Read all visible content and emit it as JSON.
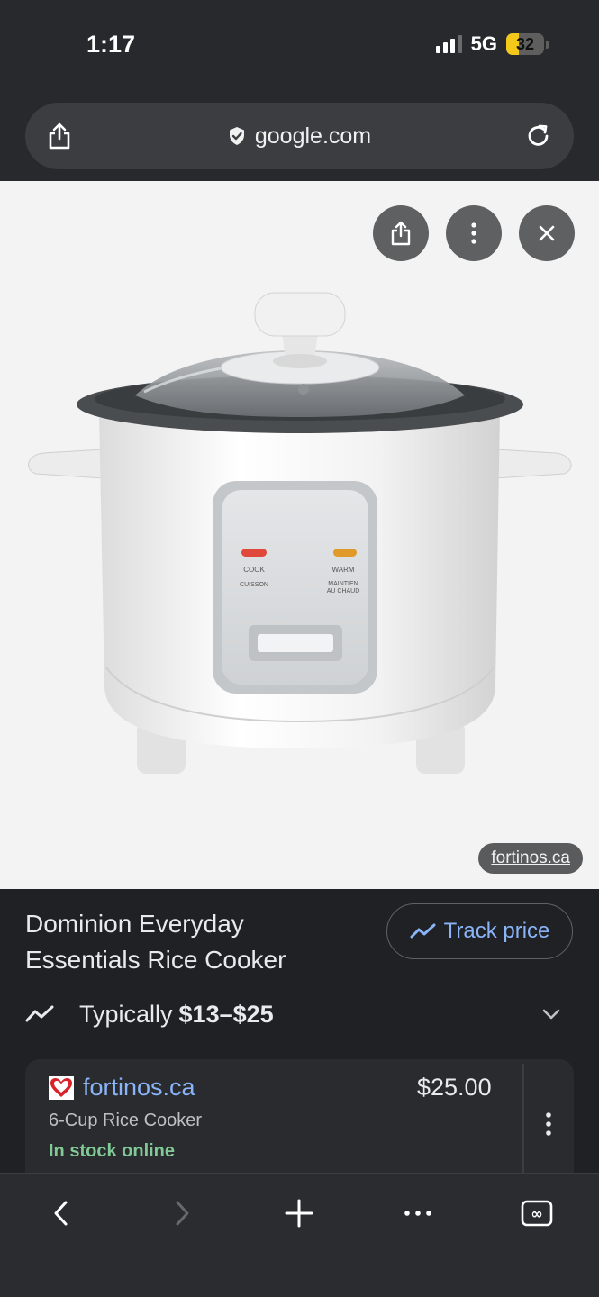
{
  "status_bar": {
    "time": "1:17",
    "network": "5G",
    "battery": "32"
  },
  "browser": {
    "url": "google.com",
    "icons": [
      "share-icon",
      "shield-icon",
      "reload-icon"
    ]
  },
  "image_viewer": {
    "source_label": "fortinos.ca",
    "panel_labels": {
      "cook": "COOK",
      "cuisson": "CUISSON",
      "warm": "WARM",
      "maintien_1": "MAINTIEN",
      "maintien_2": "AU CHAUD"
    },
    "buttons": [
      "share-icon",
      "more-vert-icon",
      "close-icon"
    ]
  },
  "product": {
    "title_line1": "Dominion Everyday",
    "title_line2": "Essentials Rice Cooker",
    "track_price_label": "Track price",
    "typical_label": "Typically",
    "typical_range": "$13–$25"
  },
  "offer": {
    "merchant": "fortinos.ca",
    "price": "$25.00",
    "description": "6-Cup Rice Cooker",
    "stock_status": "In stock online"
  },
  "toolbar": {
    "buttons": [
      "back-icon",
      "forward-icon",
      "new-tab-icon",
      "more-icon",
      "tabs-icon"
    ],
    "tabs_count": "∞"
  },
  "colors": {
    "accent_blue": "#8ab4f8",
    "in_stock_green": "#81c995",
    "background": "#202124"
  }
}
